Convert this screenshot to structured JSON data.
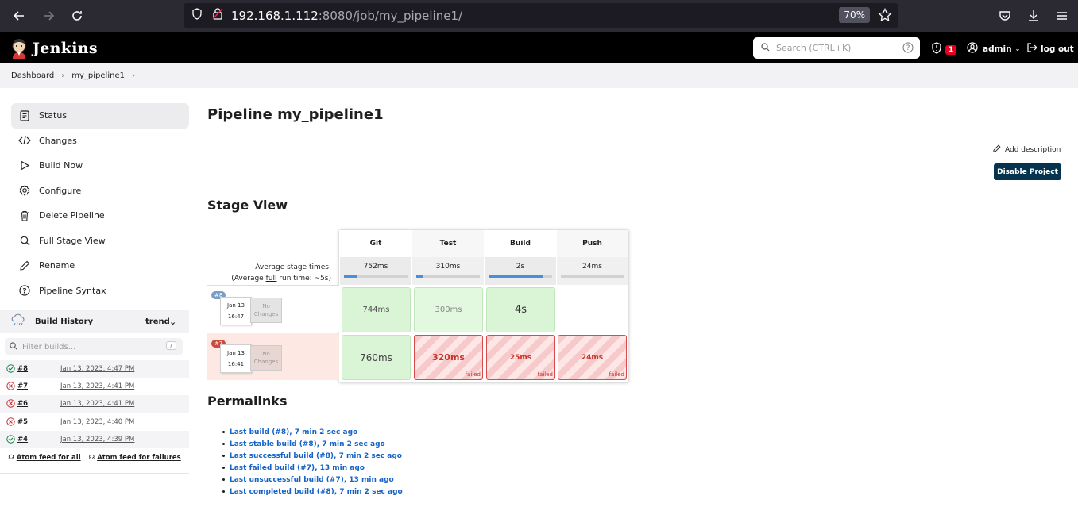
{
  "browser": {
    "url_host": "192.168.1.112",
    "url_rest": ":8080/job/my_pipeline1/",
    "zoom": "70%"
  },
  "header": {
    "brand": "Jenkins",
    "search_placeholder": "Search (CTRL+K)",
    "notification_count": "1",
    "user": "admin",
    "logout": "log out"
  },
  "breadcrumb": [
    "Dashboard",
    "my_pipeline1"
  ],
  "sidebar": {
    "tasks": [
      {
        "label": "Status",
        "icon": "document-icon"
      },
      {
        "label": "Changes",
        "icon": "code-icon"
      },
      {
        "label": "Build Now",
        "icon": "play-icon"
      },
      {
        "label": "Configure",
        "icon": "gear-icon"
      },
      {
        "label": "Delete Pipeline",
        "icon": "trash-icon"
      },
      {
        "label": "Full Stage View",
        "icon": "search-icon"
      },
      {
        "label": "Rename",
        "icon": "pencil-icon"
      },
      {
        "label": "Pipeline Syntax",
        "icon": "help-icon"
      }
    ],
    "build_history": {
      "title": "Build History",
      "trend": "trend",
      "filter_placeholder": "Filter builds...",
      "filter_shortcut": "/",
      "builds": [
        {
          "num": "#8",
          "date": "Jan 13, 2023, 4:47 PM",
          "status": "success"
        },
        {
          "num": "#7",
          "date": "Jan 13, 2023, 4:41 PM",
          "status": "failed"
        },
        {
          "num": "#6",
          "date": "Jan 13, 2023, 4:41 PM",
          "status": "failed"
        },
        {
          "num": "#5",
          "date": "Jan 13, 2023, 4:40 PM",
          "status": "failed"
        },
        {
          "num": "#4",
          "date": "Jan 13, 2023, 4:39 PM",
          "status": "success"
        }
      ],
      "feed_all": "Atom feed for all",
      "feed_failures": "Atom feed for failures"
    }
  },
  "main": {
    "title": "Pipeline my_pipeline1",
    "add_description": "Add description",
    "disable_button": "Disable Project",
    "stage_view_title": "Stage View",
    "avg_label_1": "Average stage times:",
    "avg_label_2_pre": "(Average ",
    "avg_label_2_full": "full",
    "avg_label_2_post": " run time: ~5s)",
    "stages": [
      {
        "name": "Git",
        "avg": "752ms",
        "avg_fraction": 0.21
      },
      {
        "name": "Test",
        "avg": "310ms",
        "avg_fraction": 0.1
      },
      {
        "name": "Build",
        "avg": "2s",
        "avg_fraction": 0.85
      },
      {
        "name": "Push",
        "avg": "24ms",
        "avg_fraction": 0.0
      }
    ],
    "runs": [
      {
        "badge": "#8",
        "date": "Jan 13",
        "time": "16:47",
        "changes": "No Changes",
        "cells": [
          {
            "v": "744ms",
            "s": "ok"
          },
          {
            "v": "300ms",
            "s": "ok"
          },
          {
            "v": "4s",
            "s": "ok"
          },
          {
            "v": "",
            "s": "empty"
          }
        ]
      },
      {
        "badge": "#7",
        "date": "Jan 13",
        "time": "16:41",
        "changes": "No Changes",
        "cells": [
          {
            "v": "760ms",
            "s": "ok"
          },
          {
            "v": "320ms",
            "s": "fail"
          },
          {
            "v": "25ms",
            "s": "fail"
          },
          {
            "v": "24ms",
            "s": "fail"
          }
        ]
      }
    ],
    "failed_label": "failed",
    "permalinks_title": "Permalinks",
    "permalinks": [
      "Last build (#8), 7 min 2 sec ago",
      "Last stable build (#8), 7 min 2 sec ago",
      "Last successful build (#8), 7 min 2 sec ago",
      "Last failed build (#7), 13 min ago",
      "Last unsuccessful build (#7), 13 min ago",
      "Last completed build (#8), 7 min 2 sec ago"
    ]
  }
}
